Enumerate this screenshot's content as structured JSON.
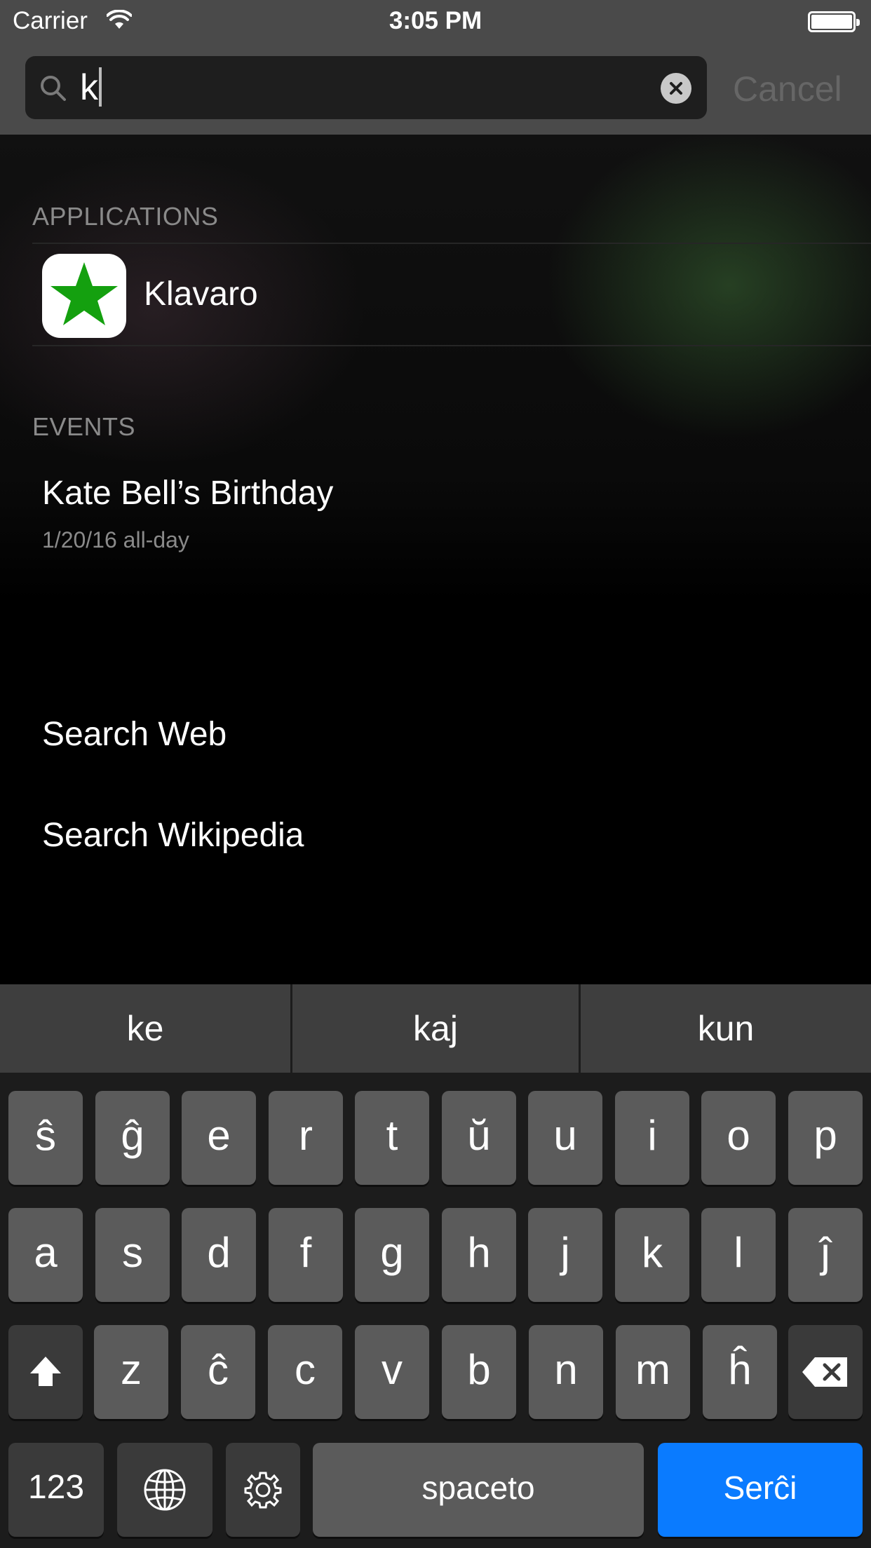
{
  "status_bar": {
    "carrier": "Carrier",
    "time": "3:05 PM"
  },
  "search": {
    "query": "k",
    "cancel_label": "Cancel"
  },
  "results": {
    "applications_header": "APPLICATIONS",
    "apps": [
      {
        "name": "Klavaro",
        "icon": "green-star-icon"
      }
    ],
    "events_header": "EVENTS",
    "events": [
      {
        "title": "Kate Bell’s Birthday",
        "detail": "1/20/16 all-day"
      }
    ],
    "search_web": "Search Web",
    "search_wikipedia": "Search Wikipedia"
  },
  "keyboard": {
    "suggestions": [
      "ke",
      "kaj",
      "kun"
    ],
    "row1": [
      "ŝ",
      "ĝ",
      "e",
      "r",
      "t",
      "ŭ",
      "u",
      "i",
      "o",
      "p"
    ],
    "row2": [
      "a",
      "s",
      "d",
      "f",
      "g",
      "h",
      "j",
      "k",
      "l",
      "ĵ"
    ],
    "row3": [
      "z",
      "ĉ",
      "c",
      "v",
      "b",
      "n",
      "m",
      "ĥ"
    ],
    "numbers_label": "123",
    "space_label": "spaceto",
    "search_label": "Serĉi"
  },
  "colors": {
    "accent": "#0a7bff",
    "star_green": "#14a00f"
  }
}
